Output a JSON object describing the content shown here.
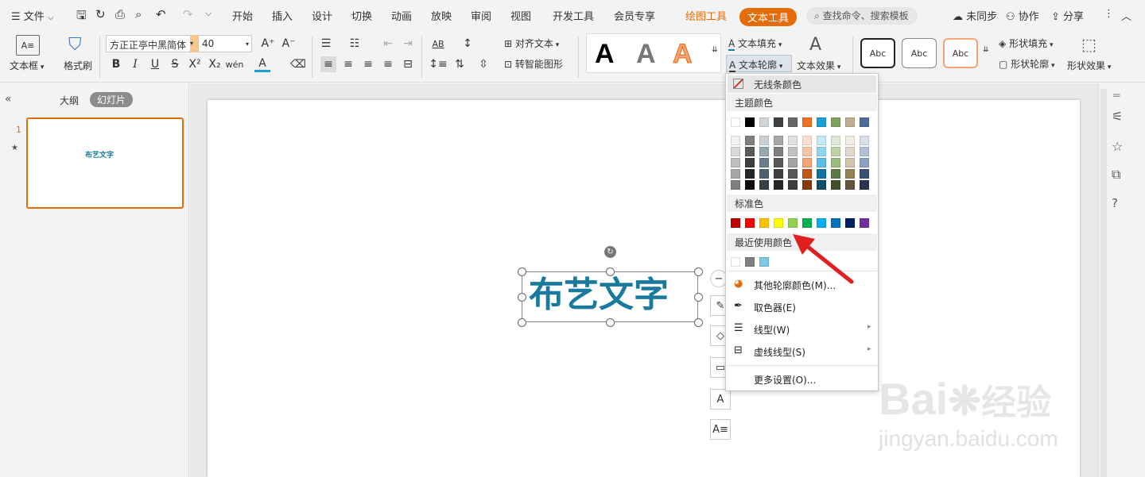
{
  "menubar": {
    "file": "文件",
    "tabs": [
      "开始",
      "插入",
      "设计",
      "切换",
      "动画",
      "放映",
      "审阅",
      "视图",
      "开发工具",
      "会员专享"
    ],
    "drawing_tools": "绘图工具",
    "text_tools": "文本工具",
    "search": "查找命令、搜索模板",
    "unsync": "未同步",
    "collab": "协作",
    "share": "分享"
  },
  "ribbon": {
    "textbox": "文本框",
    "format_painter": "格式刷",
    "font_name": "方正正亭中黑简体",
    "font_size": "40",
    "align_text": "对齐文本",
    "smart_shape": "转智能图形",
    "text_fill": "文本填充",
    "text_outline": "文本轮廓",
    "text_effect": "文本效果",
    "shape_fill": "形状填充",
    "shape_outline": "形状轮廓",
    "shape_effect": "形状效果",
    "style_letter": "A",
    "abc": "Abc"
  },
  "left": {
    "outline": "大纲",
    "slides": "幻灯片",
    "slide_number": "1",
    "thumb_text": "布艺文字"
  },
  "slide": {
    "text": "布艺文字"
  },
  "dropdown": {
    "no_line": "无线条颜色",
    "theme_colors": "主题颜色",
    "standard_colors": "标准色",
    "recent_colors": "最近使用颜色",
    "more_colors": "其他轮廓颜色(M)...",
    "eyedropper": "取色器(E)",
    "line_type": "线型(W)",
    "dash_type": "虚线线型(S)",
    "more_settings": "更多设置(O)..."
  },
  "theme": {
    "row1": [
      "#ffffff",
      "#000000",
      "#d0d5da",
      "#404040",
      "#666666",
      "#f07123",
      "#1a9fd8",
      "#7fa15c",
      "#bfae92",
      "#4f6b9a"
    ],
    "shades": [
      [
        "#f2f2f2",
        "#7f7f7f",
        "#c9d1d6",
        "#a6a6a6",
        "#e0e0e0",
        "#fde0cf",
        "#c6e9f8",
        "#dde9d2",
        "#f0ebe3",
        "#d7dfea"
      ],
      [
        "#d9d9d9",
        "#595959",
        "#96a8b3",
        "#7f7f7f",
        "#c2c2c2",
        "#fac3a4",
        "#8fd4f1",
        "#bcd3a6",
        "#e2d7c8",
        "#b1c0d6"
      ],
      [
        "#bfbfbf",
        "#3f3f3f",
        "#687f8d",
        "#595959",
        "#a3a3a3",
        "#f6a375",
        "#57beea",
        "#9bbd7b",
        "#d3c3ac",
        "#8ba2c2"
      ],
      [
        "#a6a6a6",
        "#262626",
        "#4f616c",
        "#404040",
        "#575757",
        "#c55514",
        "#13749f",
        "#5b7a41",
        "#978156",
        "#3a5075"
      ],
      [
        "#7f7f7f",
        "#0d0d0d",
        "#353f46",
        "#262626",
        "#3d3d3d",
        "#833909",
        "#0c4d6a",
        "#3d512b",
        "#64553a",
        "#27354e"
      ]
    ]
  },
  "standard": [
    "#c00000",
    "#ff0000",
    "#ffc000",
    "#ffff00",
    "#92d050",
    "#00b050",
    "#00b0f0",
    "#0070c0",
    "#002060",
    "#7030a0"
  ],
  "recent": [
    "#ffffff",
    "#808080",
    "#7ec8e3"
  ],
  "watermark": {
    "brand": "Bai",
    "brand2": "经验",
    "url": "jingyan.baidu.com"
  },
  "colors": {
    "accent": "#e46c0a",
    "text_blue": "#1a7a9e",
    "arrow": "#e02020"
  }
}
